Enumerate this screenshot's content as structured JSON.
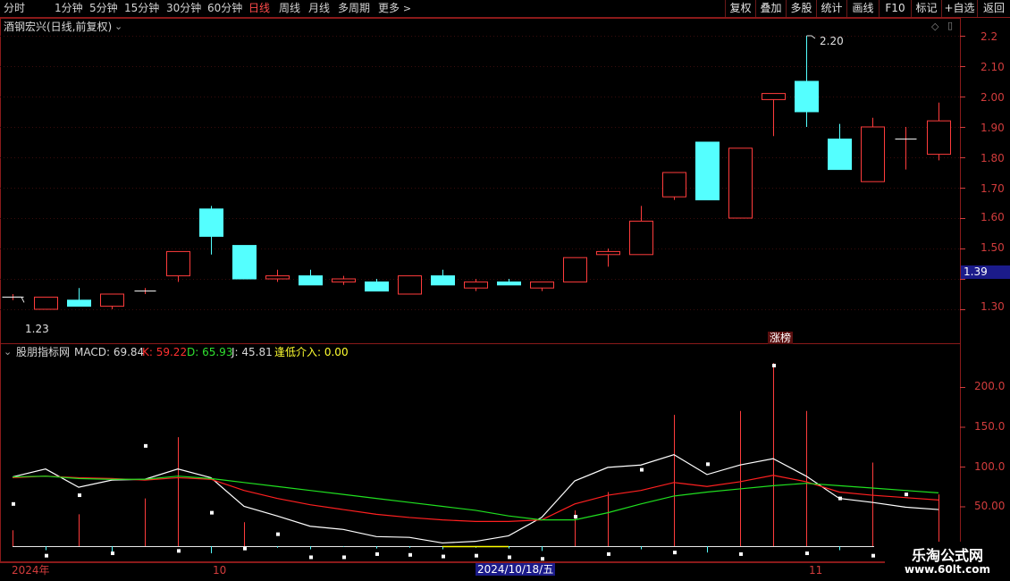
{
  "toolbar": {
    "left_tabs": [
      "分时",
      "1分钟",
      "5分钟",
      "15分钟",
      "30分钟",
      "60分钟",
      "日线",
      "周线",
      "月线",
      "多周期",
      "更多"
    ],
    "active_tab": "日线",
    "more_icon": "chevron-right-icon",
    "right_buttons": [
      "复权",
      "叠加",
      "多股",
      "统计",
      "画线",
      "F10",
      "标记",
      "+自选",
      "返回"
    ]
  },
  "main_panel": {
    "title": "酒钢宏兴(日线,前复权)",
    "dropdown_icon": "chevron-down-circle-icon",
    "diamond_icon": "diamond-icon",
    "scroll_icon": "scroll-toggle-icon",
    "high_label": "2.20",
    "low_label": "1.23",
    "current_price_tag": "1.39",
    "badge": "涨榜"
  },
  "indicator_panel": {
    "title": "股朋指标网",
    "macd_label": "MACD: 69.84",
    "k_label": "K: 59.22",
    "d_label": "D: 65.93",
    "j_label": "J: 45.81",
    "signal_label": "逢低介入: 0.00"
  },
  "x_axis": {
    "labels": [
      "2024年",
      "10",
      "2024/10/18/五",
      "11"
    ]
  },
  "watermark": {
    "title": "乐淘公式网",
    "url": "www.60lt.com"
  },
  "colors": {
    "up": "#ff3c3c",
    "down": "#54ffff",
    "axis": "#d23c3c",
    "k_line": "#ffffff",
    "d_line": "#ff2020",
    "j_line": "#20e020",
    "signal": "#ffff00"
  },
  "chart_data": [
    {
      "type": "candlestick",
      "title": "酒钢宏兴(日线,前复权)",
      "y_ticks": [
        2.2,
        2.1,
        2.0,
        1.9,
        1.8,
        1.7,
        1.6,
        1.5,
        1.4,
        1.3
      ],
      "ylim": [
        1.19,
        2.24
      ],
      "candles": [
        {
          "o": 1.34,
          "h": 1.35,
          "l": 1.33,
          "c": 1.34
        },
        {
          "o": 1.3,
          "h": 1.34,
          "l": 1.3,
          "c": 1.34
        },
        {
          "o": 1.33,
          "h": 1.37,
          "l": 1.31,
          "c": 1.31
        },
        {
          "o": 1.31,
          "h": 1.35,
          "l": 1.3,
          "c": 1.35
        },
        {
          "o": 1.36,
          "h": 1.37,
          "l": 1.35,
          "c": 1.36
        },
        {
          "o": 1.41,
          "h": 1.49,
          "l": 1.39,
          "c": 1.49
        },
        {
          "o": 1.63,
          "h": 1.64,
          "l": 1.48,
          "c": 1.54
        },
        {
          "o": 1.51,
          "h": 1.51,
          "l": 1.4,
          "c": 1.4
        },
        {
          "o": 1.4,
          "h": 1.43,
          "l": 1.39,
          "c": 1.41
        },
        {
          "o": 1.41,
          "h": 1.43,
          "l": 1.38,
          "c": 1.38
        },
        {
          "o": 1.39,
          "h": 1.41,
          "l": 1.38,
          "c": 1.4
        },
        {
          "o": 1.39,
          "h": 1.4,
          "l": 1.36,
          "c": 1.36
        },
        {
          "o": 1.35,
          "h": 1.41,
          "l": 1.35,
          "c": 1.41
        },
        {
          "o": 1.41,
          "h": 1.43,
          "l": 1.38,
          "c": 1.38
        },
        {
          "o": 1.37,
          "h": 1.4,
          "l": 1.36,
          "c": 1.39
        },
        {
          "o": 1.39,
          "h": 1.4,
          "l": 1.38,
          "c": 1.38
        },
        {
          "o": 1.37,
          "h": 1.39,
          "l": 1.36,
          "c": 1.39
        },
        {
          "o": 1.39,
          "h": 1.47,
          "l": 1.39,
          "c": 1.47
        },
        {
          "o": 1.48,
          "h": 1.5,
          "l": 1.44,
          "c": 1.49
        },
        {
          "o": 1.48,
          "h": 1.64,
          "l": 1.48,
          "c": 1.59
        },
        {
          "o": 1.67,
          "h": 1.75,
          "l": 1.66,
          "c": 1.75
        },
        {
          "o": 1.85,
          "h": 1.85,
          "l": 1.66,
          "c": 1.66
        },
        {
          "o": 1.6,
          "h": 1.83,
          "l": 1.6,
          "c": 1.83
        },
        {
          "o": 1.99,
          "h": 2.01,
          "l": 1.87,
          "c": 2.01
        },
        {
          "o": 2.05,
          "h": 2.2,
          "l": 1.9,
          "c": 1.95
        },
        {
          "o": 1.86,
          "h": 1.91,
          "l": 1.76,
          "c": 1.76
        },
        {
          "o": 1.72,
          "h": 1.93,
          "l": 1.72,
          "c": 1.9
        },
        {
          "o": 1.86,
          "h": 1.9,
          "l": 1.76,
          "c": 1.86
        },
        {
          "o": 1.81,
          "h": 1.98,
          "l": 1.79,
          "c": 1.92
        }
      ]
    },
    {
      "type": "line",
      "title": "股朋指标网",
      "y_ticks": [
        200.0,
        150.0,
        100.0,
        50.0
      ],
      "ylim": [
        -20,
        245
      ],
      "series": [
        {
          "name": "K",
          "values": [
            87,
            97,
            74,
            83,
            84,
            97,
            86,
            50,
            38,
            25,
            21,
            12,
            11,
            4,
            6,
            13,
            36,
            82,
            99,
            102,
            115,
            90,
            102,
            110,
            88,
            60,
            55,
            49,
            46
          ]
        },
        {
          "name": "D",
          "values": [
            86,
            88,
            86,
            85,
            83,
            86,
            84,
            70,
            60,
            52,
            46,
            40,
            36,
            33,
            31,
            31,
            33,
            53,
            64,
            70,
            80,
            75,
            81,
            89,
            81,
            68,
            64,
            61,
            58
          ]
        },
        {
          "name": "J",
          "values": [
            87,
            88,
            85,
            84,
            84,
            88,
            85,
            80,
            75,
            70,
            65,
            60,
            55,
            50,
            45,
            38,
            33,
            33,
            42,
            53,
            63,
            68,
            72,
            76,
            79,
            76,
            73,
            70,
            67
          ]
        }
      ],
      "macd_bars": [
        20,
        -5,
        40,
        -8,
        60,
        137,
        -9,
        30,
        -2,
        -4,
        -1,
        -3,
        -2,
        -4,
        -2,
        -3,
        -6,
        45,
        68,
        -4,
        165,
        -8,
        170,
        230,
        170,
        -5,
        105,
        -2,
        65
      ],
      "signal_marks": [
        53,
        -12,
        64,
        -9,
        126,
        -6,
        42,
        -3,
        15,
        -14,
        -14,
        -10,
        -11,
        -13,
        -12,
        -14,
        -16,
        37,
        -10,
        96,
        -8,
        103,
        -10,
        227,
        -9,
        60,
        -12,
        65,
        -10
      ]
    }
  ]
}
